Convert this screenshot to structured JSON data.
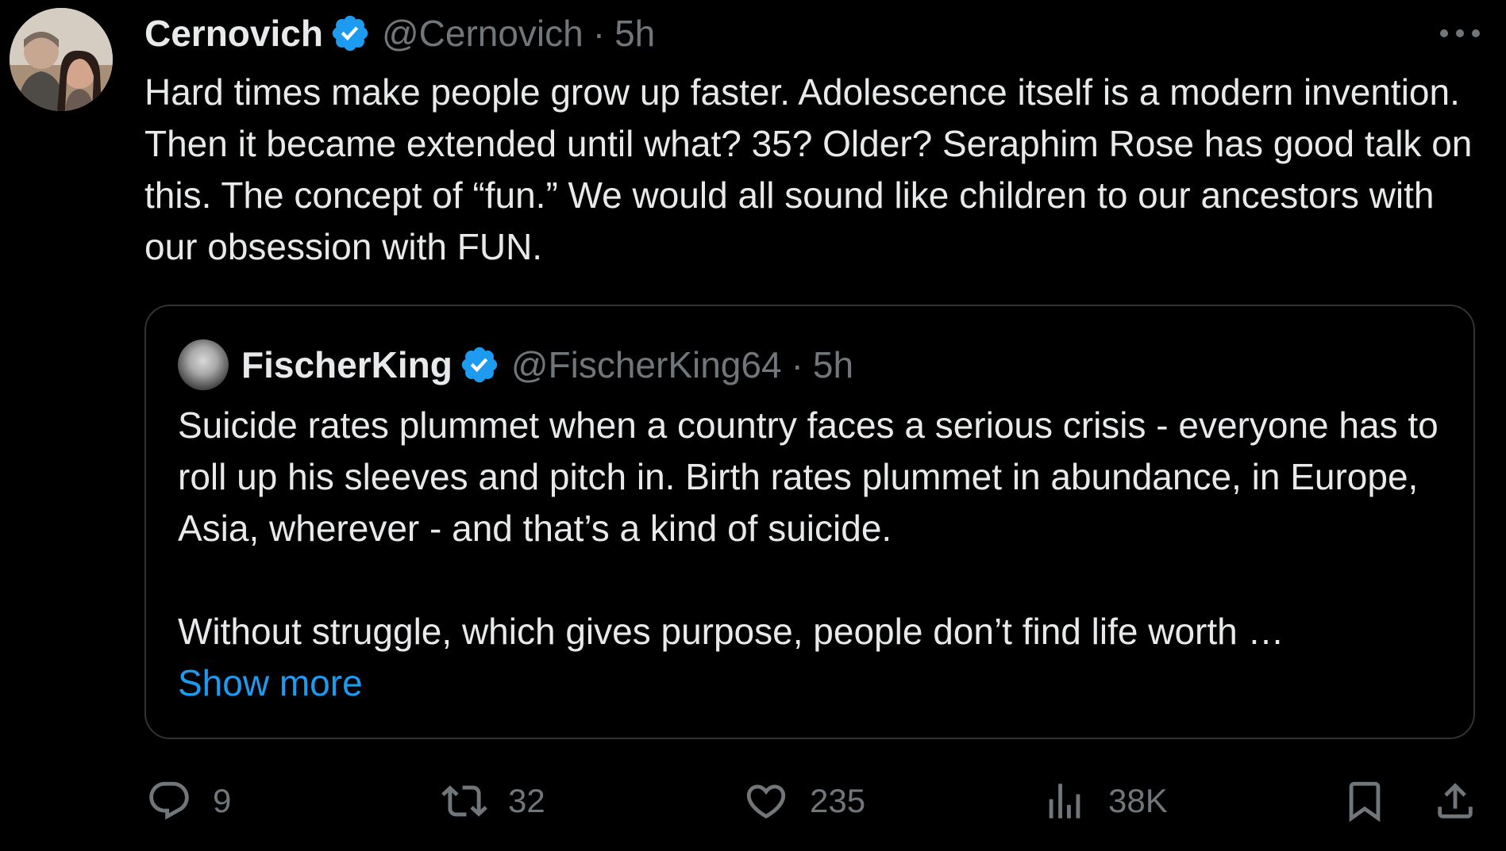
{
  "tweet": {
    "display_name": "Cernovich",
    "handle": "@Cernovich",
    "separator": "·",
    "time": "5h",
    "text": "Hard times make people grow up faster. Adolescence itself is a modern invention. Then it became extended until what? 35? Older? Seraphim Rose has good talk on this. The concept of “fun.” We would all sound like children to our ancestors with our obsession with FUN."
  },
  "quote": {
    "display_name": "FischerKing",
    "handle": "@FischerKing64",
    "separator": "·",
    "time": "5h",
    "paragraph1": "Suicide rates plummet when a country faces a serious crisis - everyone has to roll up his sleeves and pitch in. Birth rates plummet in abundance, in Europe, Asia, wherever - and that’s a kind of suicide.",
    "paragraph2": "Without struggle, which gives purpose, people don’t find life worth …",
    "show_more": "Show more"
  },
  "actions": {
    "replies": "9",
    "reposts": "32",
    "likes": "235",
    "views": "38K"
  },
  "colors": {
    "background": "#000000",
    "text": "#e7e9ea",
    "muted": "#71767b",
    "accent": "#1d9bf0",
    "border": "#2f3336"
  },
  "icons": [
    "more-icon",
    "verified-badge-icon",
    "reply-icon",
    "repost-icon",
    "like-icon",
    "views-icon",
    "bookmark-icon",
    "share-icon"
  ]
}
